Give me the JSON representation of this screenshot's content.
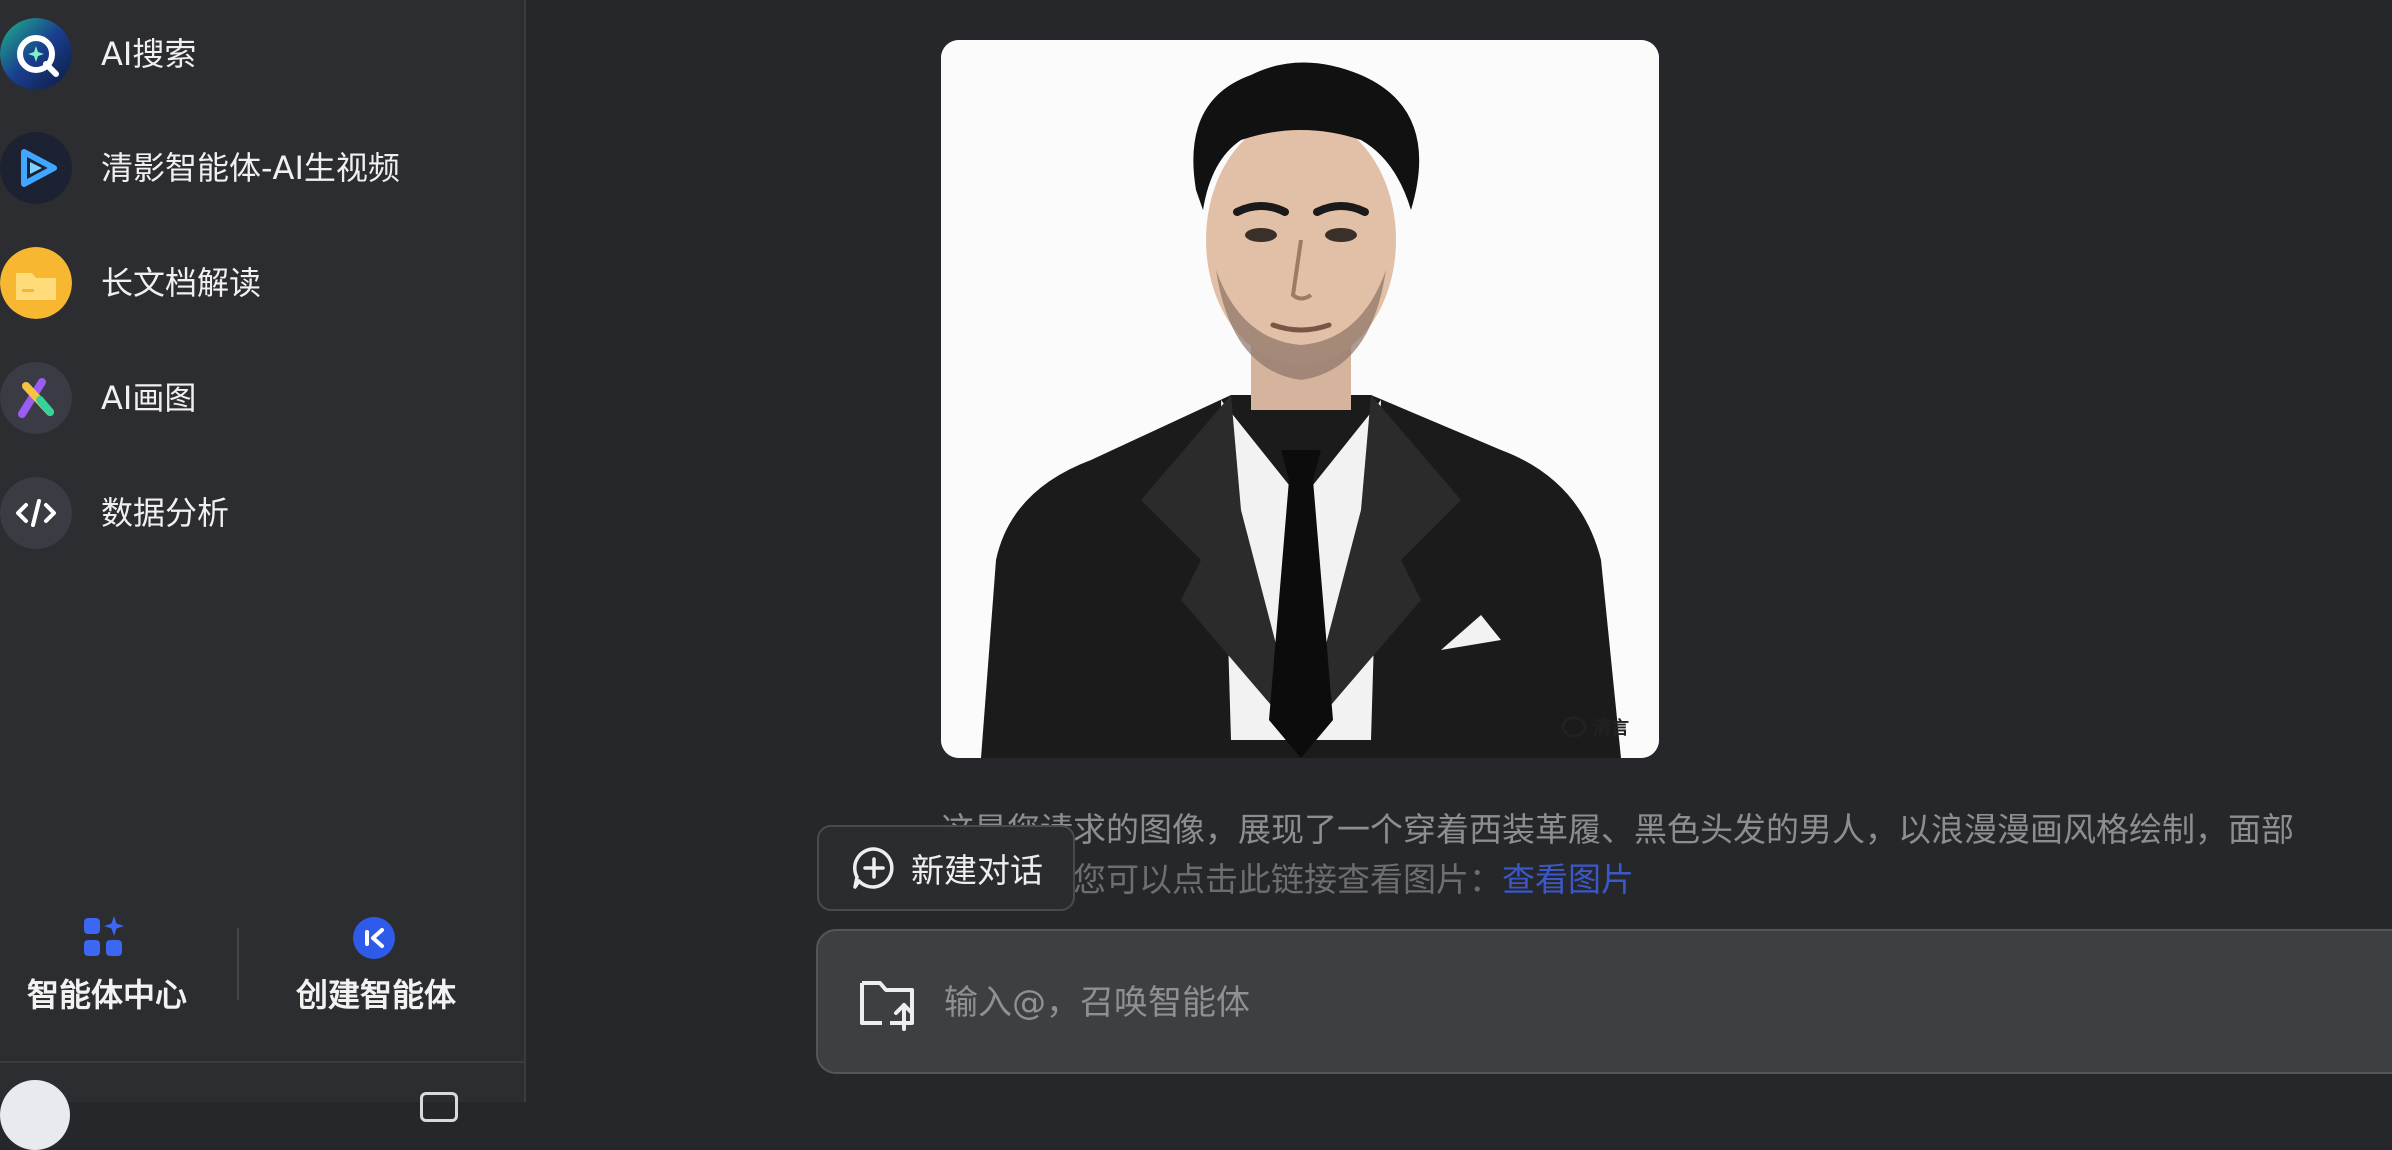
{
  "sidebar": {
    "items": [
      {
        "label": "AI搜索",
        "icon": "ai-search-icon"
      },
      {
        "label": "清影智能体-AI生视频",
        "icon": "video-play-icon"
      },
      {
        "label": "长文档解读",
        "icon": "folder-icon"
      },
      {
        "label": "AI画图",
        "icon": "paint-x-icon"
      },
      {
        "label": "数据分析",
        "icon": "code-icon"
      }
    ],
    "actions": {
      "agent_center": "智能体中心",
      "create_agent": "创建智能体"
    }
  },
  "main": {
    "image": {
      "alt_icon": "generated-portrait-image",
      "watermark": "清言"
    },
    "answer_line1": "这是您请求的图像，展现了一个穿着西装革履、黑色头发的男人，以浪漫漫画风格绘制，面部",
    "answer_line2_prefix": "的期望！您可以点击此链接查看图片：",
    "answer_link": "查看图片",
    "new_chat_label": "新建对话",
    "input_placeholder": "输入@，召唤智能体"
  },
  "colors": {
    "accent": "#2f5bea",
    "sidebar_bg": "#2c2d30",
    "main_bg": "#26272a"
  }
}
